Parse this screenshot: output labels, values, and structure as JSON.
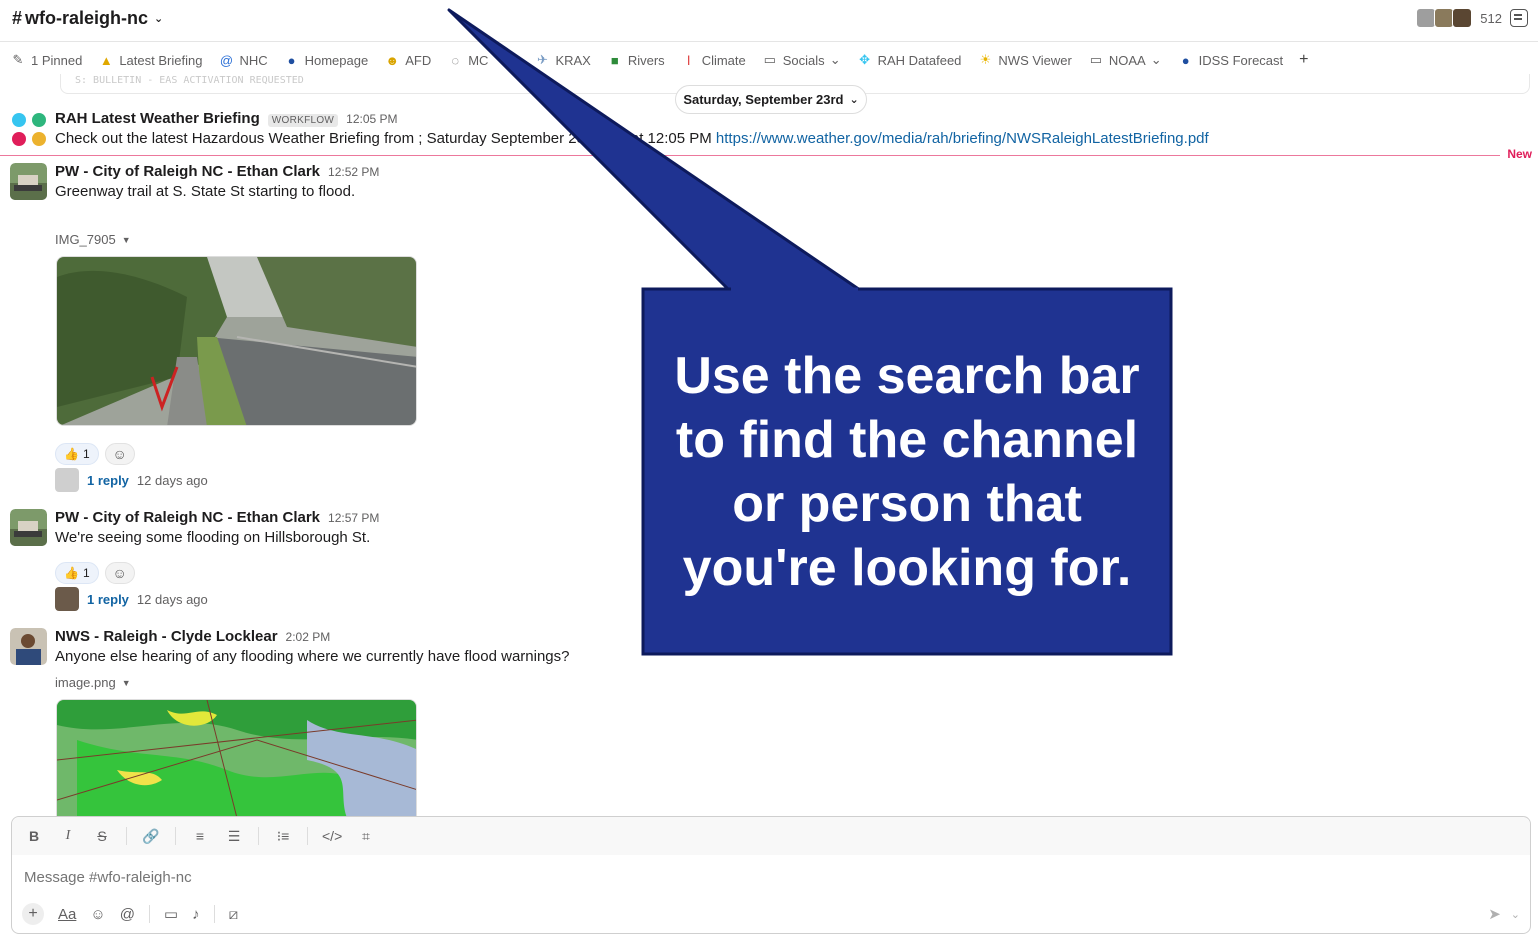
{
  "header": {
    "channel_name": "wfo-raleigh-nc",
    "member_count": "512"
  },
  "bookmarks": [
    {
      "label": "1 Pinned",
      "icon": "pin-icon"
    },
    {
      "label": "Latest Briefing",
      "icon": "warning-icon"
    },
    {
      "label": "NHC",
      "icon": "hurricane-icon"
    },
    {
      "label": "Homepage",
      "icon": "noaa-icon"
    },
    {
      "label": "AFD",
      "icon": "emoji-icon"
    },
    {
      "label": "MC",
      "icon": "speech-bubble-icon"
    },
    {
      "label": "KRAX",
      "icon": "radar-icon"
    },
    {
      "label": "Rivers",
      "icon": "map-icon"
    },
    {
      "label": "Climate",
      "icon": "thermometer-icon"
    },
    {
      "label": "Socials",
      "icon": "folder-icon"
    },
    {
      "label": "RAH Datafeed",
      "icon": "slack-icon"
    },
    {
      "label": "NWS Viewer",
      "icon": "weather-icon"
    },
    {
      "label": "NOAA",
      "icon": "folder-icon"
    },
    {
      "label": "IDSS Forecast",
      "icon": "noaa-icon"
    }
  ],
  "ghost_text": "S: BULLETIN - EAS ACTIVATION REQUESTED",
  "date_divider": "Saturday, September 23rd",
  "new_label": "New",
  "messages": [
    {
      "author": "RAH Latest Weather Briefing",
      "badge": "WORKFLOW",
      "time": "12:05 PM",
      "text": "Check out the latest Hazardous Weather Briefing from ; Saturday September 23, 2023 at 12:05 PM",
      "link": "https://www.weather.gov/media/rah/briefing/NWSRaleighLatestBriefing.pdf"
    },
    {
      "author": "PW - City of Raleigh NC - Ethan Clark",
      "time": "12:52 PM",
      "text": "Greenway trail at S. State St starting to flood.",
      "file": "IMG_7905",
      "reaction_count": "1",
      "reply": "1 reply",
      "reply_age": "12 days ago"
    },
    {
      "author": "PW - City of Raleigh NC - Ethan Clark",
      "time": "12:57 PM",
      "text": "We're seeing some flooding on Hillsborough St.",
      "reaction_count": "1",
      "reply": "1 reply",
      "reply_age": "12 days ago"
    },
    {
      "author": "NWS - Raleigh - Clyde Locklear",
      "time": "2:02 PM",
      "text": "Anyone else hearing of any flooding where we currently have flood warnings?",
      "file": "image.png"
    }
  ],
  "composer": {
    "placeholder": "Message #wfo-raleigh-nc"
  },
  "callout": {
    "text": "Use the search bar to find the channel or person that you're looking for.",
    "fill": "#1f3391",
    "border": "#0d1a5c"
  }
}
